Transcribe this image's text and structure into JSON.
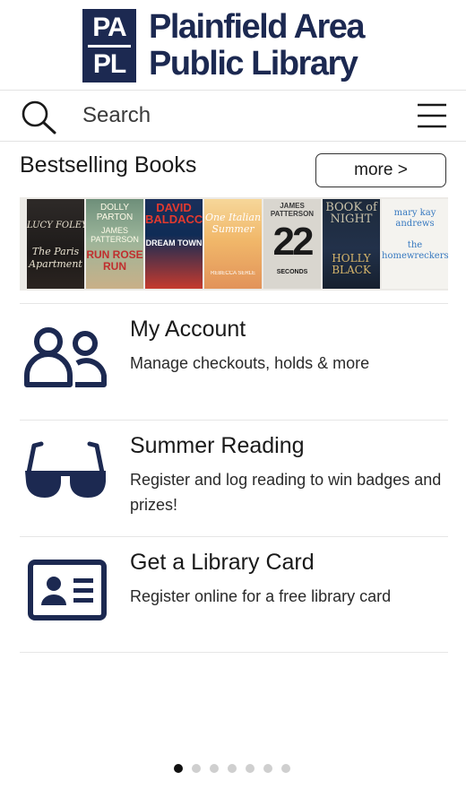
{
  "logo": {
    "mark_top": "PA",
    "mark_bottom": "PL",
    "line1": "Plainfield Area",
    "line2": "Public Library"
  },
  "search": {
    "placeholder": "Search"
  },
  "bestsellers": {
    "title": "Bestselling Books",
    "more_label": "more >",
    "books": [
      {
        "t1": "LUCY FOLEY",
        "t2": "The Paris Apartment"
      },
      {
        "t1": "DOLLY PARTON",
        "t2": "JAMES PATTERSON",
        "t3": "RUN ROSE RUN"
      },
      {
        "t1": "DAVID BALDACCI",
        "t2": "DREAM TOWN"
      },
      {
        "t1": "One Italian Summer",
        "t2": "REBECCA SERLE"
      },
      {
        "t1": "JAMES PATTERSON",
        "t2": "22",
        "t3": "SECONDS"
      },
      {
        "t1": "BOOK of NIGHT",
        "t2": "HOLLY BLACK"
      },
      {
        "t1": "mary kay andrews",
        "t2": "the homewreckers"
      }
    ]
  },
  "menu": {
    "items": [
      {
        "title": "My Account",
        "desc": "Manage checkouts, holds & more",
        "icon": "users-icon"
      },
      {
        "title": "Summer Reading",
        "desc": "Register and log reading to win badges and prizes!",
        "icon": "sunglasses-icon"
      },
      {
        "title": "Get a Library Card",
        "desc": "Register online for a free library card",
        "icon": "id-card-icon"
      }
    ]
  },
  "pagination": {
    "total_pages": 7,
    "current_page": 1
  },
  "colors": {
    "brand_navy": "#1c2951",
    "dot_active": "#111111",
    "dot_inactive": "#cfcfcf"
  }
}
